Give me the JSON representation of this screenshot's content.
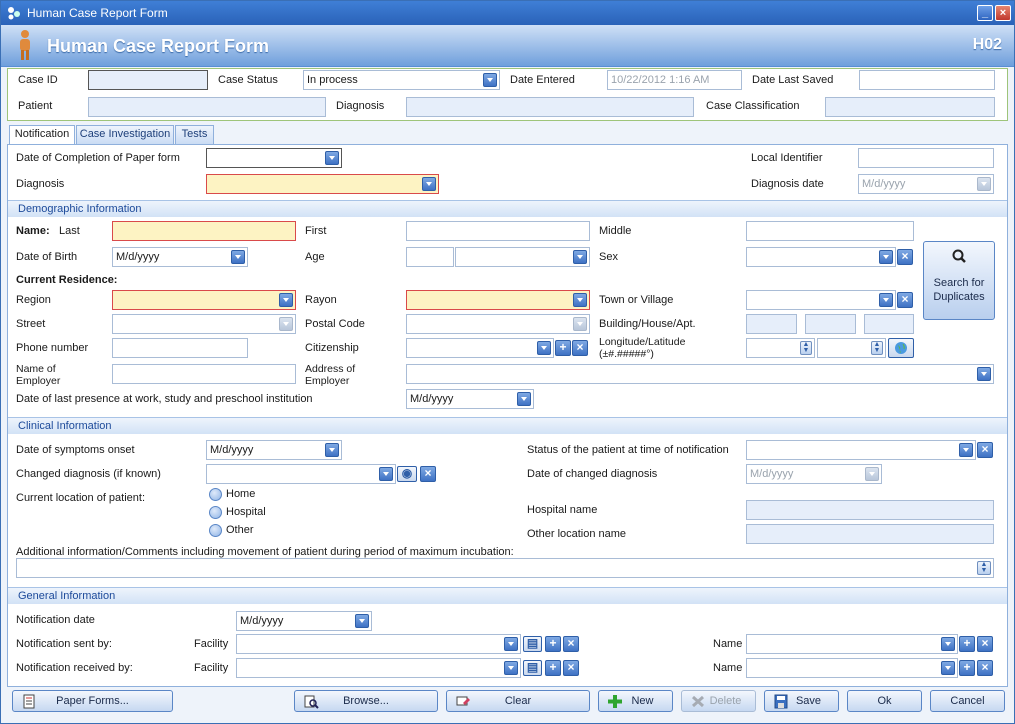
{
  "window": {
    "title": "Human Case Report Form"
  },
  "header": {
    "title": "Human Case Report Form",
    "code": "H02"
  },
  "top": {
    "case_id_label": "Case ID",
    "case_id_value": "",
    "case_status_label": "Case Status",
    "case_status_value": "In process",
    "date_entered_label": "Date Entered",
    "date_entered_value": "10/22/2012 1:16 AM",
    "date_last_saved_label": "Date Last Saved",
    "date_last_saved_value": "",
    "patient_label": "Patient",
    "diagnosis_label": "Diagnosis",
    "case_classification_label": "Case Classification"
  },
  "tabs": [
    "Notification",
    "Case Investigation",
    "Tests"
  ],
  "notification": {
    "date_completion_label": "Date of Completion of Paper form",
    "local_identifier_label": "Local Identifier",
    "diagnosis_label": "Diagnosis",
    "diagnosis_date_label": "Diagnosis date",
    "diagnosis_date_value": "M/d/yyyy"
  },
  "demographic": {
    "section_title": "Demographic Information",
    "name_label": "Name:",
    "last_label": "Last",
    "first_label": "First",
    "middle_label": "Middle",
    "dob_label": "Date of Birth",
    "dob_value": "M/d/yyyy",
    "age_label": "Age",
    "sex_label": "Sex",
    "current_residence_label": "Current Residence:",
    "region_label": "Region",
    "rayon_label": "Rayon",
    "town_label": "Town or Village",
    "street_label": "Street",
    "postal_label": "Postal Code",
    "building_label": "Building/House/Apt.",
    "phone_label": "Phone number",
    "citizenship_label": "Citizenship",
    "lonlat_label": "Longitude/Latitude (±#.#####°)",
    "employer_name_label": "Name of Employer",
    "employer_address_label": "Address of Employer",
    "last_presence_label": "Date of last presence at work, study and preschool institution",
    "last_presence_value": "M/d/yyyy",
    "search_button": "Search for Duplicates"
  },
  "clinical": {
    "section_title": "Clinical Information",
    "symptoms_onset_label": "Date of symptoms onset",
    "symptoms_onset_value": "M/d/yyyy",
    "status_label": "Status of the patient at time of notification",
    "changed_diag_label": "Changed diagnosis (if known)",
    "date_changed_label": "Date of changed diagnosis",
    "date_changed_value": "M/d/yyyy",
    "current_location_label": "Current location of patient:",
    "location_options": [
      "Home",
      "Hospital",
      "Other"
    ],
    "hospital_name_label": "Hospital name",
    "other_location_label": "Other location name",
    "additional_label": "Additional information/Comments including movement of patient during period of maximum incubation:"
  },
  "general": {
    "section_title": "General Information",
    "notification_date_label": "Notification date",
    "notification_date_value": "M/d/yyyy",
    "sent_by_label": "Notification sent by:",
    "received_by_label": "Notification received by:",
    "facility_label": "Facility",
    "name_label": "Name"
  },
  "footer": {
    "paper_forms": "Paper Forms...",
    "browse": "Browse...",
    "clear": "Clear",
    "new": "New",
    "delete": "Delete",
    "save": "Save",
    "ok": "Ok",
    "cancel": "Cancel"
  },
  "colors": {
    "accent": "#3f72c4",
    "required_bg": "#fdf3c3",
    "required_border": "#d94a4a",
    "section_text": "#1d4a9a"
  }
}
